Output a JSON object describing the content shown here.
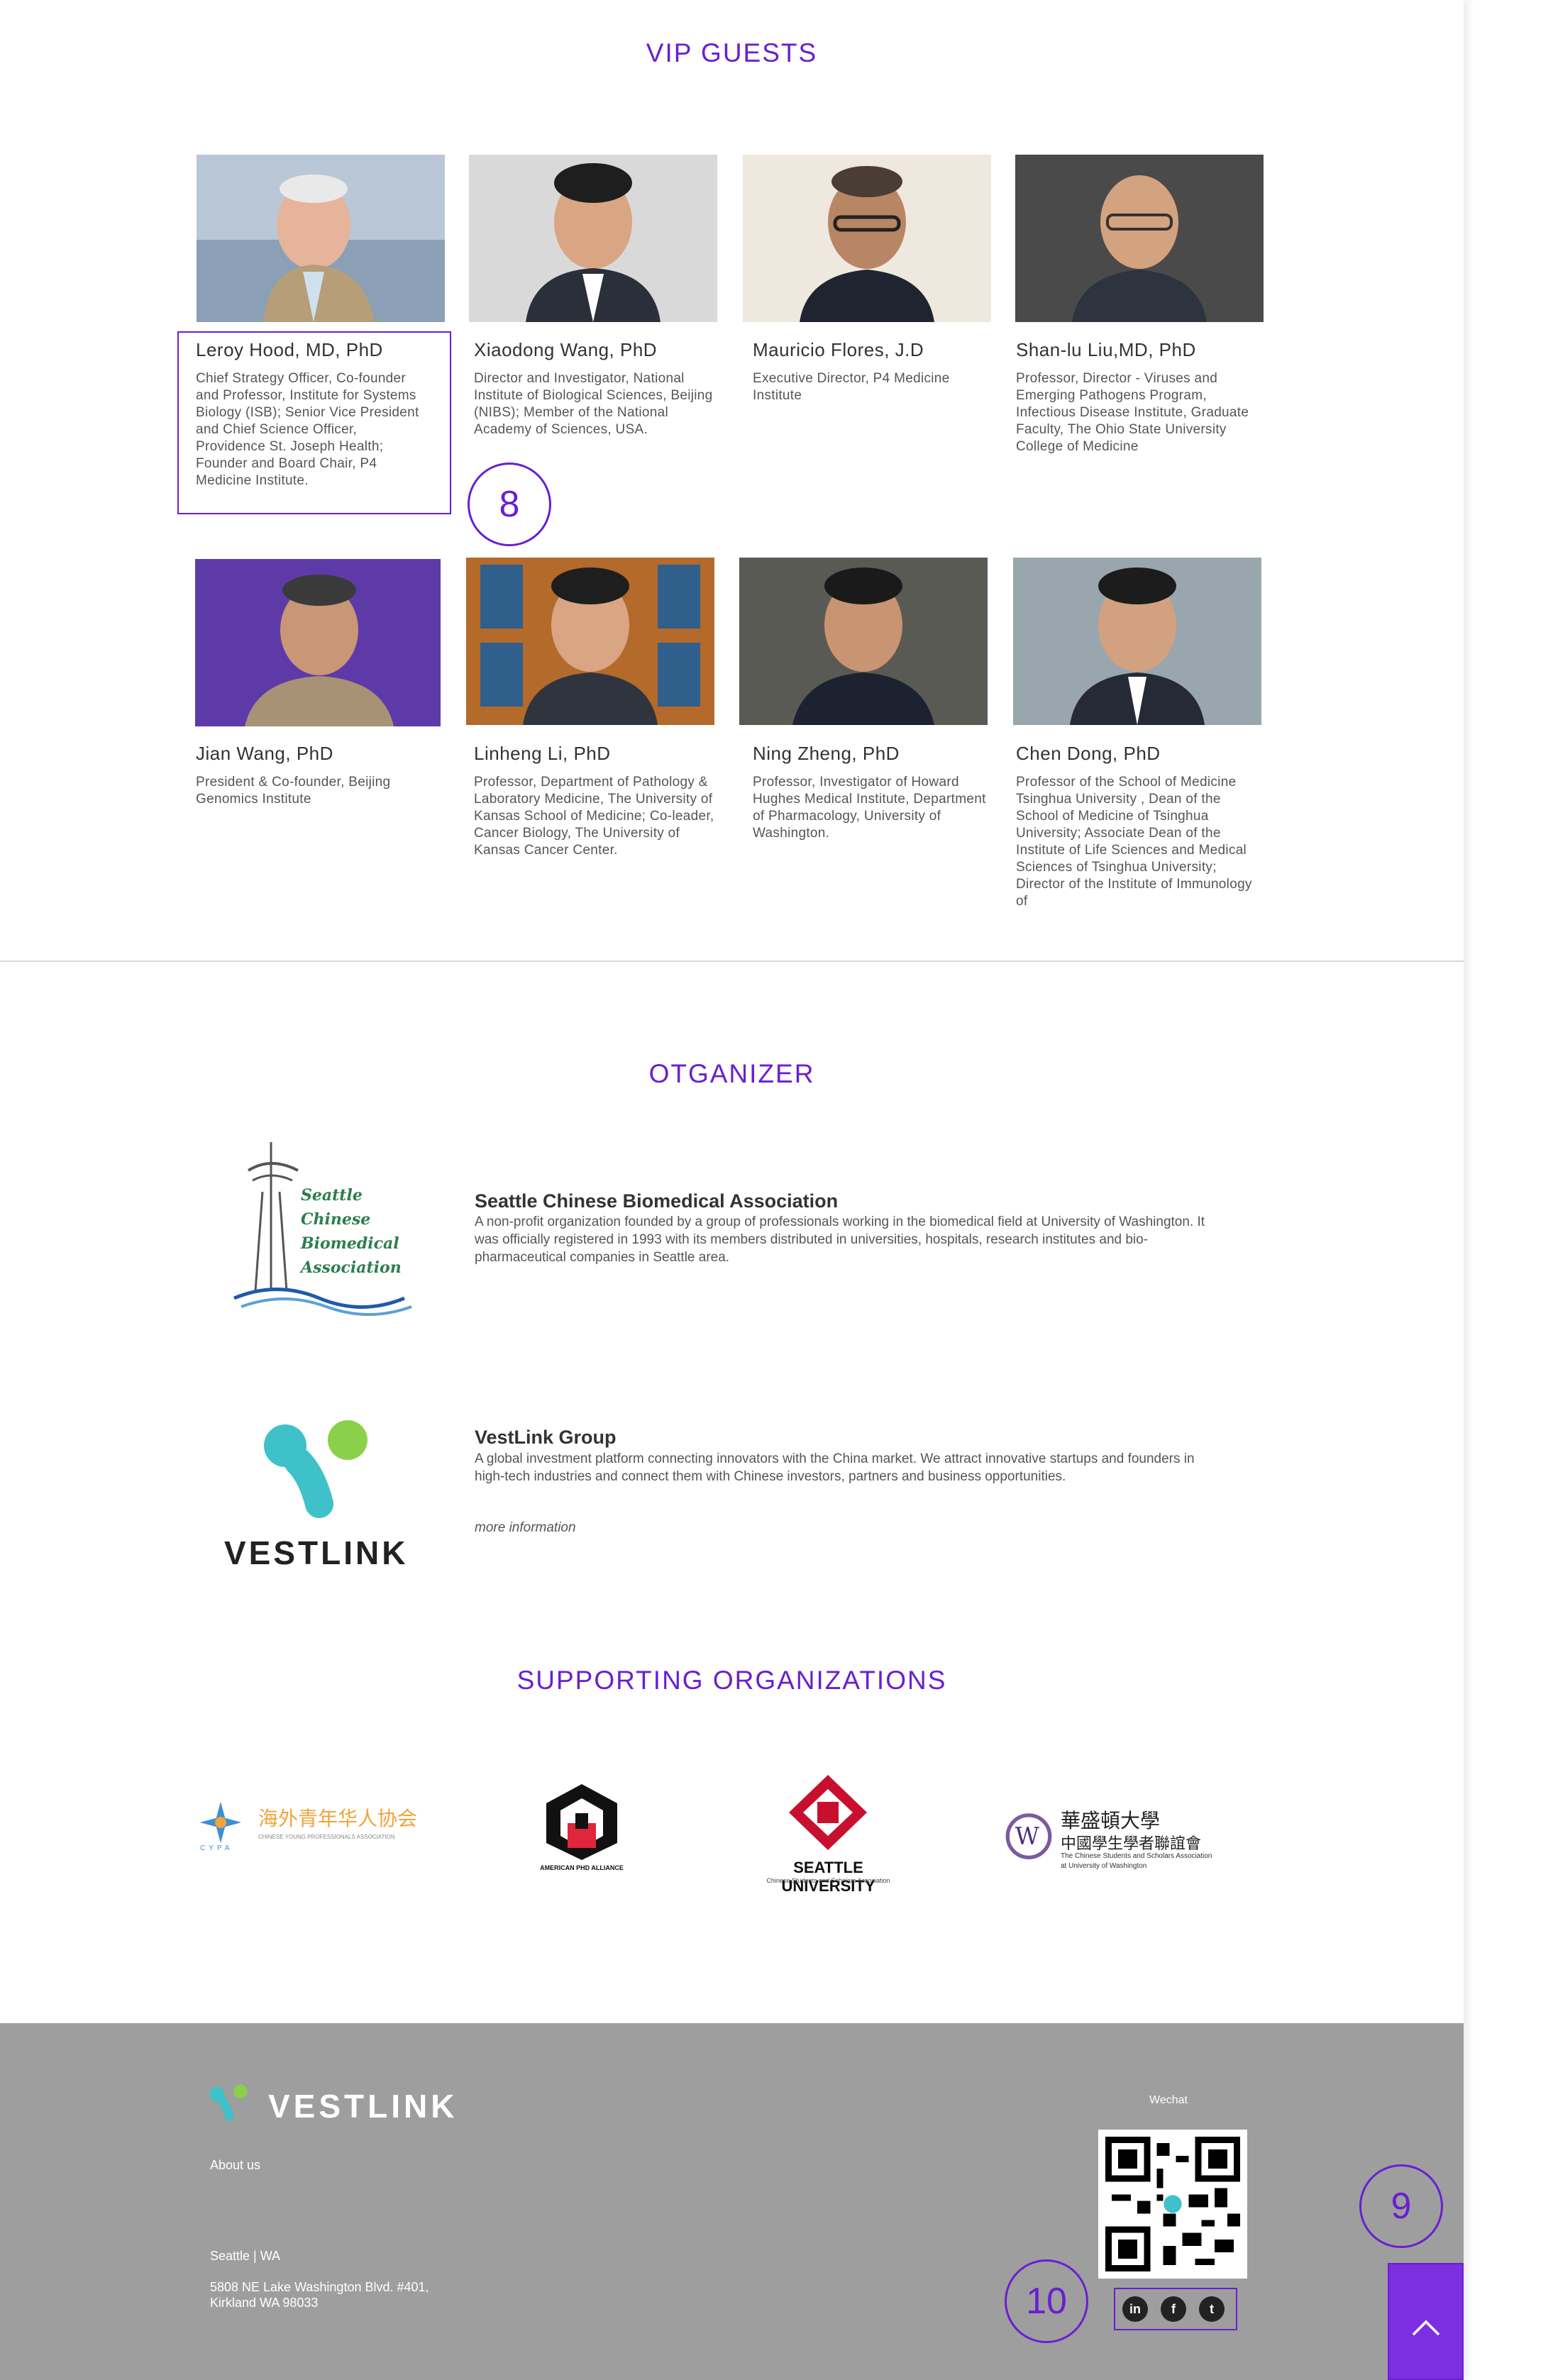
{
  "vip": {
    "title": "VIP GUESTS",
    "guests": [
      {
        "name": "Leroy Hood, MD, PhD",
        "role": "Chief Strategy Officer, Co-founder and Professor, Institute for Systems Biology (ISB); Senior Vice President and Chief Science Officer, Providence St. Joseph Health; Founder and Board Chair, P4 Medicine Institute."
      },
      {
        "name": "Xiaodong Wang, PhD",
        "role": "Director and Investigator, National Institute of Biological Sciences, Beijing (NIBS); Member of the National Academy of Sciences, USA."
      },
      {
        "name": "Mauricio Flores, J.D",
        "role": "Executive Director, P4 Medicine Institute"
      },
      {
        "name": "Shan-lu Liu,MD, PhD",
        "role": "Professor, Director - Viruses and Emerging Pathogens Program, Infectious Disease Institute, Graduate Faculty, The Ohio State University College of Medicine"
      },
      {
        "name": "Jian Wang, PhD",
        "role": "President & Co-founder, Beijing Genomics Institute"
      },
      {
        "name": "Linheng Li, PhD",
        "role": "Professor, Department of Pathology & Laboratory Medicine, The University of Kansas School of Medicine; Co-leader, Cancer Biology, The University of Kansas Cancer Center."
      },
      {
        "name": "Ning Zheng, PhD",
        "role": "Professor, Investigator of Howard Hughes Medical Institute, Department of Pharmacology, University of Washington."
      },
      {
        "name": "Chen Dong, PhD",
        "role": "Professor of the School of Medicine Tsinghua University , Dean of the School of Medicine of Tsinghua University; Associate Dean of the Institute of Life Sciences and Medical Sciences of Tsinghua University; Director of the Institute of Immunology of"
      }
    ]
  },
  "badges": {
    "b8": "8",
    "b9": "9",
    "b10": "10"
  },
  "organizer": {
    "title": "OTGANIZER",
    "orgs": [
      {
        "logo_lines": [
          "Seattle",
          "Chinese",
          "Biomedical",
          "Association"
        ],
        "name": "Seattle Chinese Biomedical Association",
        "desc": "A non-profit organization founded by a group of professionals working in the biomedical field at University of Washington. It was officially registered in 1993 with its members distributed in universities, hospitals, research institutes and bio-pharmaceutical companies in Seattle area."
      },
      {
        "logo_text": "VESTLINK",
        "name": "VestLink Group",
        "desc": "A global investment platform connecting innovators with the China market. We attract innovative startups and founders in high-tech industries and connect them with Chinese investors, partners and business opportunities.",
        "more": "more information"
      }
    ]
  },
  "supporting": {
    "title": "SUPPORTING ORGANIZATIONS",
    "cypa": {
      "abbr": "CYPA",
      "cn": "海外青年华人协会",
      "en": "CHINESE YOUNG PROFESSIONALS ASSOCIATION"
    },
    "aphd": {
      "label": "AMERICAN PHD ALLIANCE"
    },
    "seattleu": {
      "name": "SEATTLE UNIVERSITY",
      "sub": "Chinese Students and Scholars Association"
    },
    "uw": {
      "cn1": "華盛頓大學",
      "cn2": "中國學生學者聯誼會",
      "en1": "The Chinese Students and Scholars Association",
      "en2": "at University of Washington"
    }
  },
  "footer": {
    "logo_text": "VESTLINK",
    "about": "About us",
    "city": "Seattle | WA",
    "address1": "5808 NE Lake Washington Blvd. #401,",
    "address2": "Kirkland WA 98033",
    "wechat": "Wechat",
    "social": {
      "linkedin": "in",
      "facebook": "f",
      "twitter": "t"
    }
  },
  "colors": {
    "accent": "#6a1fd0",
    "footer_bg": "#9e9e9e",
    "top_button": "#7b2fe0"
  }
}
